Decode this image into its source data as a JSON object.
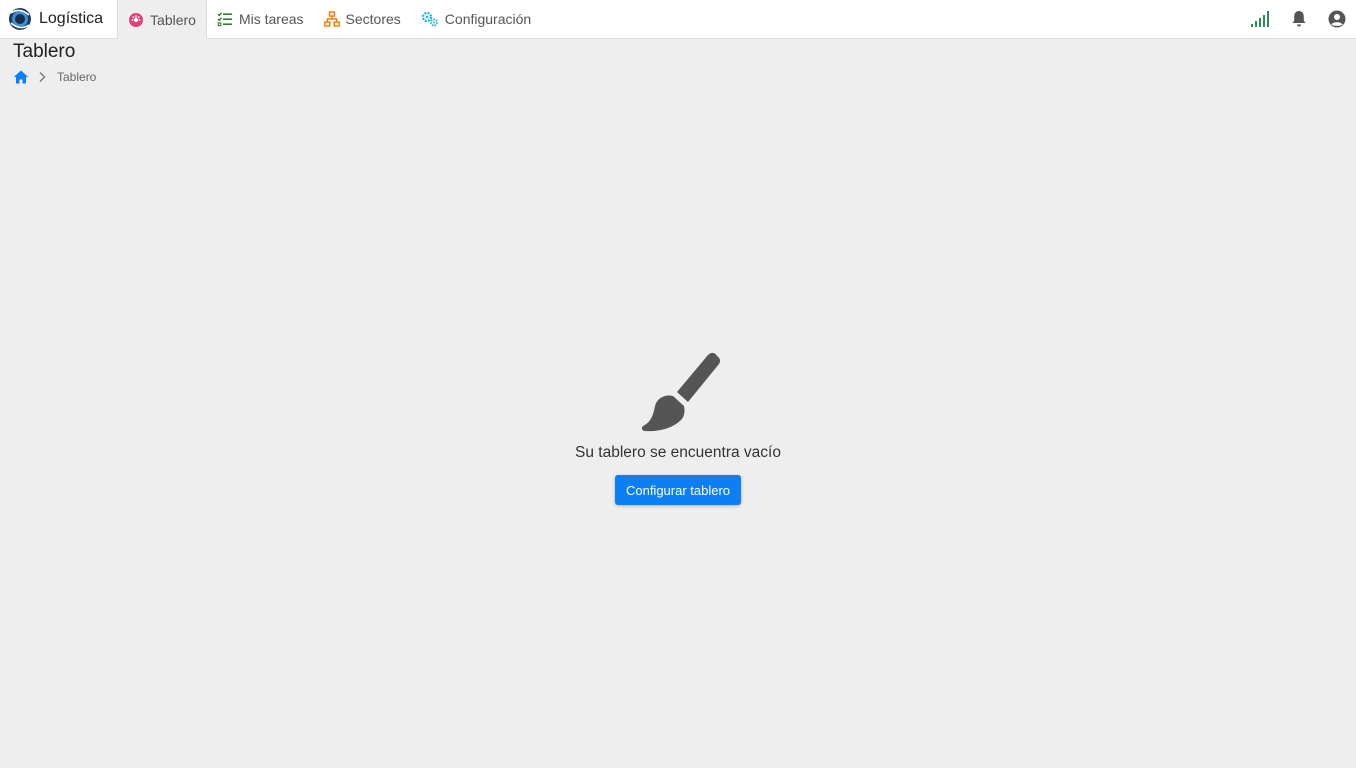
{
  "app": {
    "name": "Logística"
  },
  "nav": {
    "items": [
      {
        "label": "Tablero",
        "icon": "dashboard-icon",
        "color": "#e0407a"
      },
      {
        "label": "Mis tareas",
        "icon": "tasks-icon",
        "color": "#2e7d32"
      },
      {
        "label": "Sectores",
        "icon": "sitemap-icon",
        "color": "#f57c00"
      },
      {
        "label": "Configuración",
        "icon": "cogs-icon",
        "color": "#26b5d9"
      }
    ]
  },
  "header_icons": [
    "signal-icon",
    "bell-icon",
    "user-icon"
  ],
  "page": {
    "title": "Tablero"
  },
  "breadcrumb": {
    "current": "Tablero"
  },
  "empty_state": {
    "icon": "paint-brush-icon",
    "message": "Su tablero se encuentra vacío",
    "button_label": "Configurar tablero"
  },
  "colors": {
    "accent": "#0d7ff5",
    "background": "#eeeeee",
    "signal": "#2e8b57"
  }
}
